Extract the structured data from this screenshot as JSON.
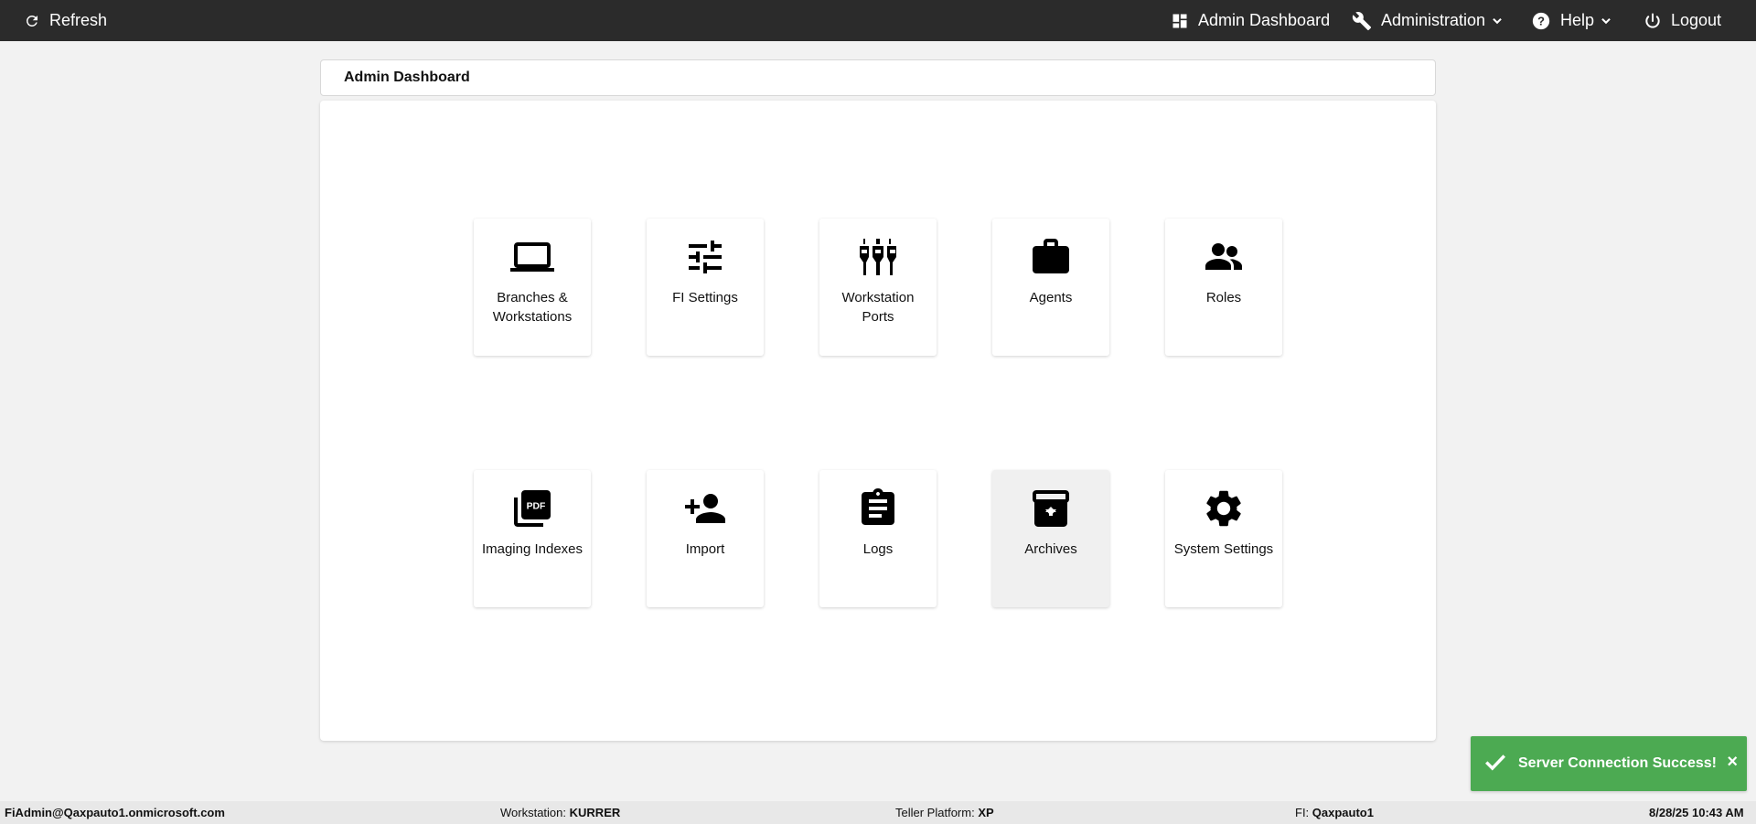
{
  "topbar": {
    "refresh_label": "Refresh",
    "dashboard_label": "Admin Dashboard",
    "administration_label": "Administration",
    "help_label": "Help",
    "logout_label": "Logout"
  },
  "page": {
    "title": "Admin Dashboard"
  },
  "tiles": [
    {
      "label": "Branches & Workstations",
      "icon": "laptop-icon"
    },
    {
      "label": "FI Settings",
      "icon": "sliders-icon"
    },
    {
      "label": "Workstation Ports",
      "icon": "ports-icon"
    },
    {
      "label": "Agents",
      "icon": "briefcase-icon"
    },
    {
      "label": "Roles",
      "icon": "users-icon"
    },
    {
      "label": "Imaging Indexes",
      "icon": "pdf-icon"
    },
    {
      "label": "Import",
      "icon": "add-user-icon"
    },
    {
      "label": "Logs",
      "icon": "clipboard-icon"
    },
    {
      "label": "Archives",
      "icon": "archive-icon"
    },
    {
      "label": "System Settings",
      "icon": "gear-icon"
    }
  ],
  "toast": {
    "message": "Server Connection Success!",
    "close_glyph": "×",
    "color": "#4caa52"
  },
  "footer": {
    "user": "FiAdmin@Qaxpauto1.onmicrosoft.com",
    "workstation_label": "Workstation:",
    "workstation_value": "KURRER",
    "teller_platform_label": "Teller Platform:",
    "teller_platform_value": "XP",
    "fi_label": "FI:",
    "fi_value": "Qaxpauto1",
    "datetime": "8/28/25 10:43 AM"
  },
  "colors": {
    "topbar_bg": "#2b2b2b",
    "page_bg": "#f2f2f2",
    "accent_success": "#4caa52"
  }
}
